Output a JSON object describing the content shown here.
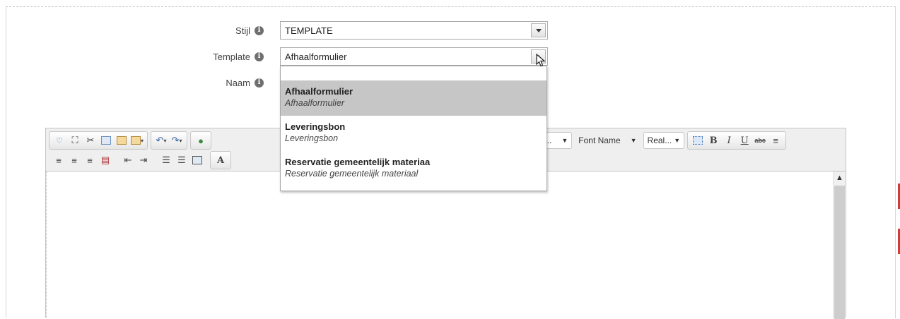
{
  "form": {
    "stijl": {
      "label": "Stijl",
      "value": "TEMPLATE"
    },
    "template": {
      "label": "Template",
      "value": "Afhaalformulier"
    },
    "naam": {
      "label": "Naam"
    }
  },
  "template_dropdown": {
    "options": [
      {
        "title": "Afhaalformulier",
        "subtitle": "Afhaalformulier",
        "selected": true
      },
      {
        "title": "Leveringsbon",
        "subtitle": "Leveringsbon",
        "selected": false
      },
      {
        "title": "Reservatie gemeentelijk materiaa",
        "subtitle": "Reservatie gemeentelijk materiaal",
        "selected": false
      }
    ]
  },
  "toolbar": {
    "format_combo": "t...",
    "font_name_combo": "Font Name",
    "size_combo": "Real..."
  },
  "colors": {
    "accent_red": "#d23b3b",
    "selected_option": "#c6c6c6"
  }
}
